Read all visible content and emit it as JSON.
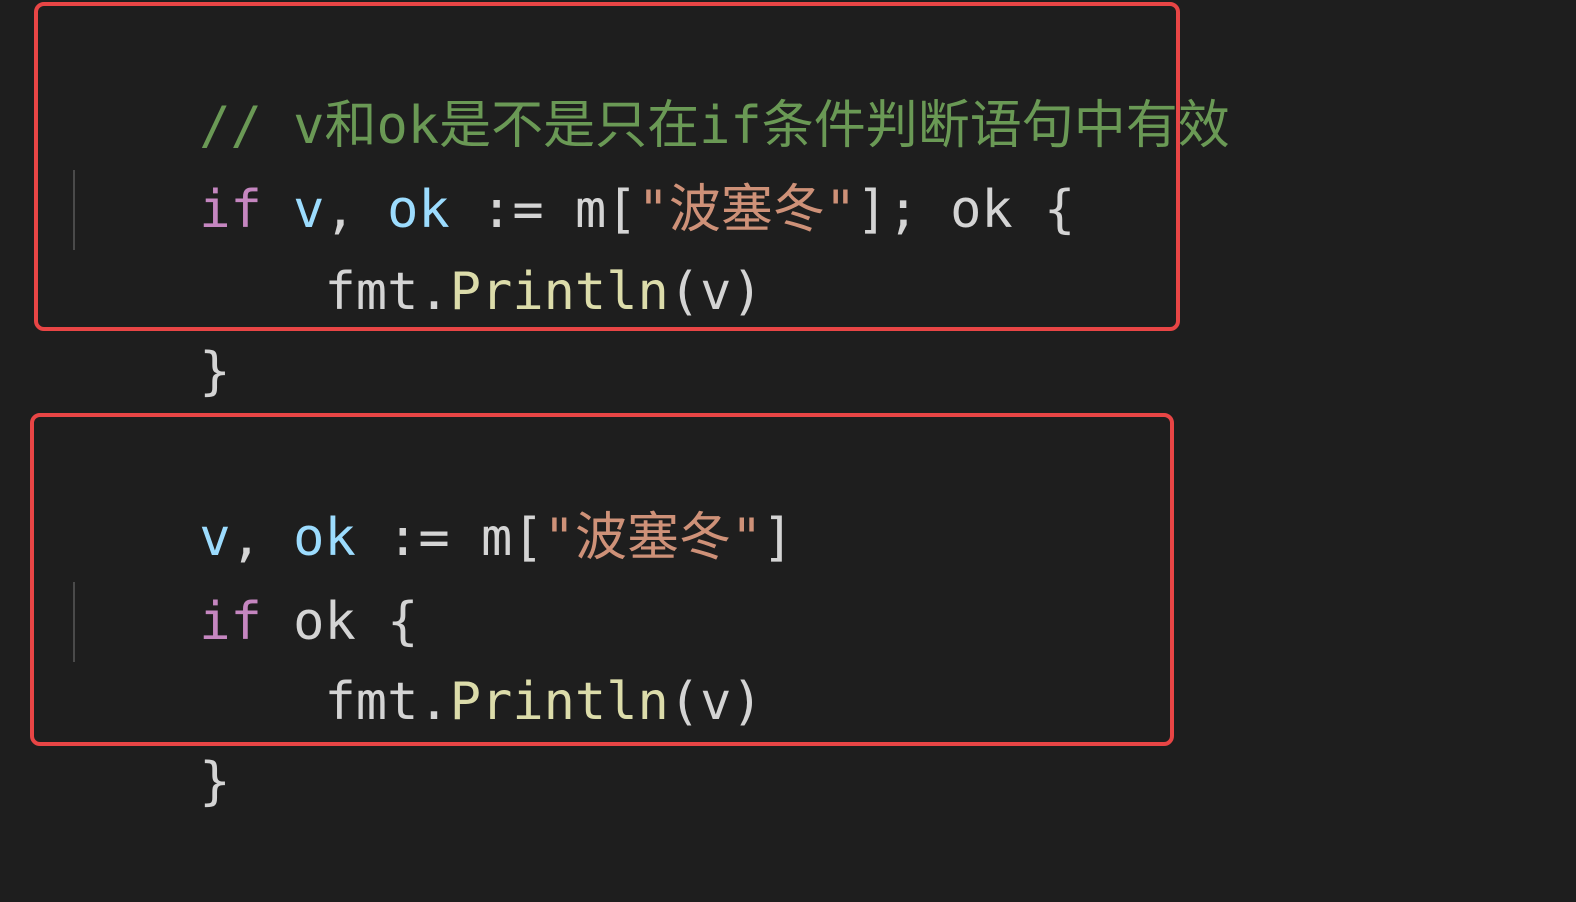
{
  "editor": {
    "theme_colors": {
      "background": "#1e1e1e",
      "comment": "#6a9955",
      "keyword": "#c586c0",
      "variable": "#9cdcfe",
      "string": "#ce9178",
      "function": "#dcdcaa",
      "text": "#d4d4d4",
      "highlight_border": "#e84545"
    },
    "block1": {
      "comment": "// v和ok是不是只在if条件判断语句中有效",
      "line2": {
        "kw_if": "if",
        "sp1": " ",
        "var_v": "v",
        "comma": ", ",
        "var_ok": "ok",
        "assign": " := m[",
        "str": "\"波塞冬\"",
        "rest": "]; ok {"
      },
      "line3": {
        "indent": "    ",
        "fmt": "fmt.",
        "println": "Println",
        "args": "(v)"
      },
      "close": "}"
    },
    "block2": {
      "line1": {
        "var_v": "v",
        "comma": ", ",
        "var_ok": "ok",
        "assign": " := m[",
        "str": "\"波塞冬\"",
        "rest": "]"
      },
      "line2": {
        "kw_if": "if",
        "rest": " ok {"
      },
      "line3": {
        "indent": "    ",
        "fmt": "fmt.",
        "println": "Println",
        "args": "(v)"
      },
      "close": "}"
    }
  }
}
